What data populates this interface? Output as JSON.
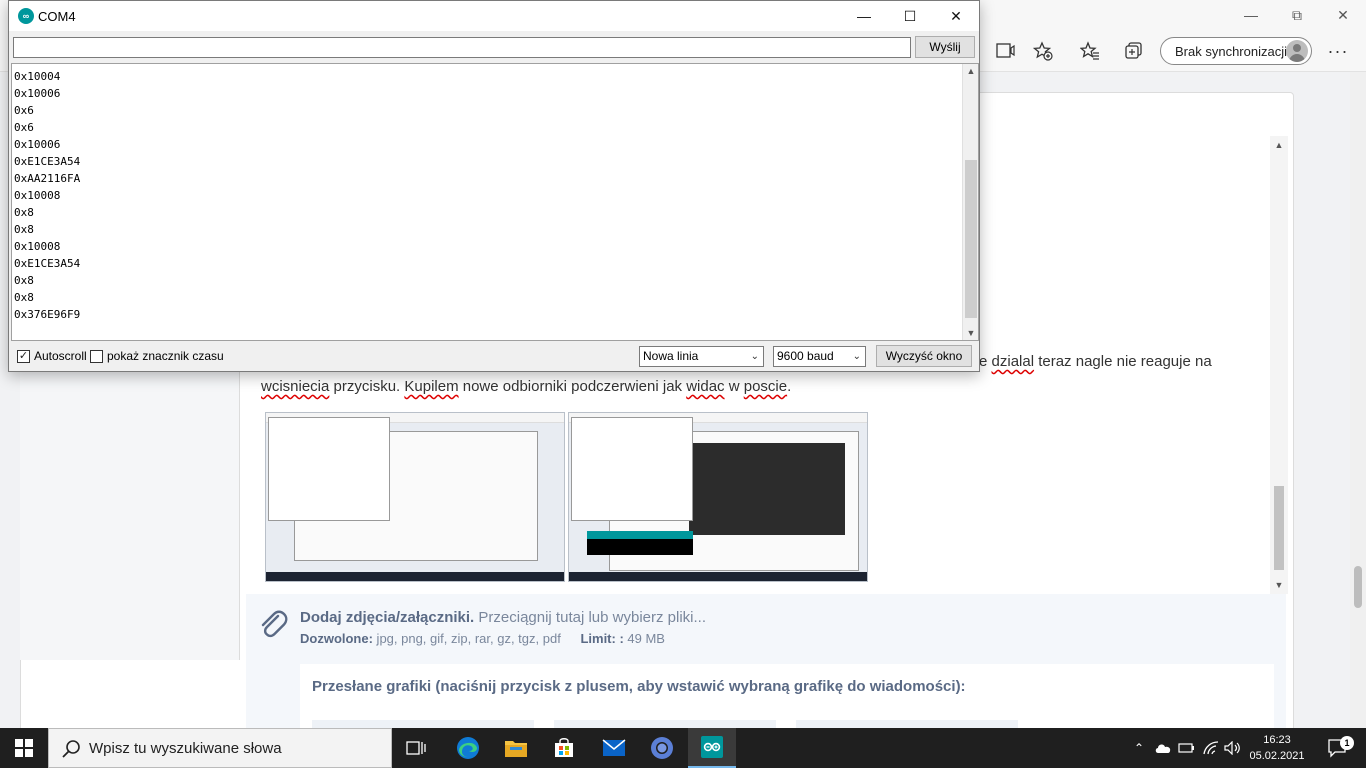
{
  "browser": {
    "sync_label": "Brak synchronizacji",
    "post_line1_pre": "e ",
    "post_line1_sp": "dzialal",
    "post_line1_post": " teraz nagle nie reaguje na",
    "post_line2_sp1": "wcisniecia",
    "post_line2_a": " przycisku. ",
    "post_line2_sp2": "Kupilem",
    "post_line2_b": " nowe odbiorniki podczerwieni jak ",
    "post_line2_sp3": "widac",
    "post_line2_c": " w ",
    "post_line2_sp4": "poscie",
    "post_line2_d": "."
  },
  "attachments": {
    "title": "Dodaj zdjęcia/załączniki.",
    "hint": " Przeciągnij tutaj lub wybierz pliki...",
    "allowed_label": "Dozwolone:",
    "allowed_value": " jpg, png, gif, zip, rar, gz, tgz, pdf",
    "limit_label": "Limit: :",
    "limit_value": " 49 MB",
    "uploads_title": "Przesłane grafiki (naciśnij przycisk z plusem, aby wstawić wybraną grafikę do wiadomości):"
  },
  "serial_monitor": {
    "title": "COM4",
    "send_label": "Wyślij",
    "input_value": "",
    "lines": [
      "0x10004",
      "0x10006",
      "0x6",
      "0x6",
      "0x10006",
      "0xE1CE3A54",
      "0xAA2116FA",
      "0x10008",
      "0x8",
      "0x8",
      "0x10008",
      "0xE1CE3A54",
      "0x8",
      "0x8",
      "0x376E96F9"
    ],
    "autoscroll_label": "Autoscroll",
    "autoscroll_checked": true,
    "timestamp_label": "pokaż znacznik czasu",
    "timestamp_checked": false,
    "line_ending": "Nowa linia",
    "baud": "9600 baud",
    "clear_label": "Wyczyść okno"
  },
  "taskbar": {
    "search_placeholder": "Wpisz tu wyszukiwane słowa",
    "time": "16:23",
    "date": "05.02.2021",
    "notification_count": "1",
    "apps": [
      "task-view-icon",
      "edge-icon",
      "file-explorer-icon",
      "store-icon",
      "mail-icon",
      "chrome-icon",
      "arduino-icon"
    ]
  },
  "colors": {
    "arduino_teal": "#00979c",
    "taskbar_bg": "#1f1f1f",
    "attach_text": "#5a6a85"
  }
}
